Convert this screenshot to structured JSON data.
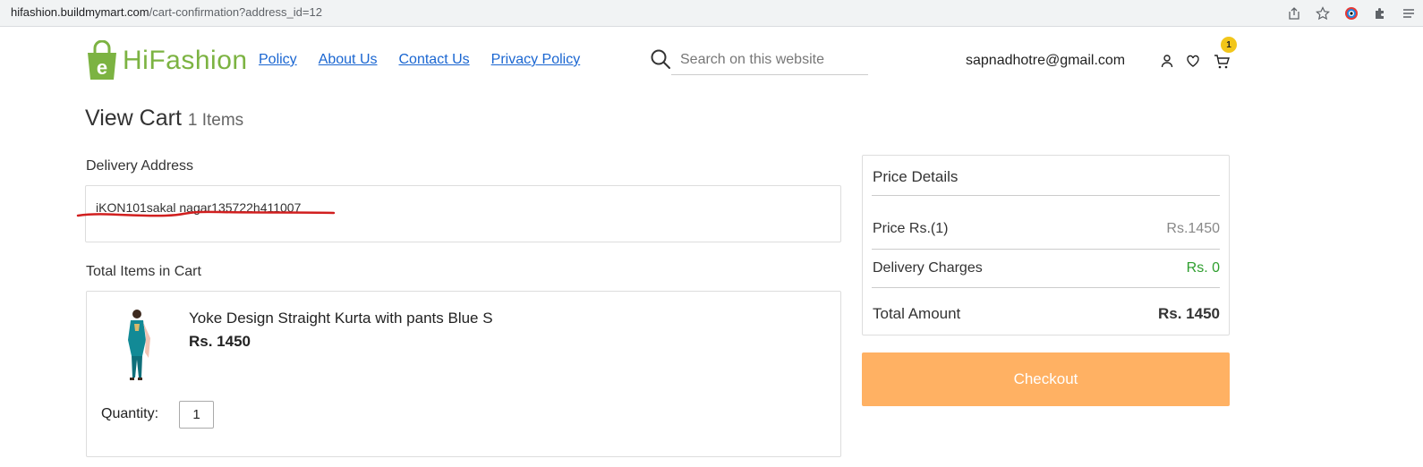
{
  "browser": {
    "url_host": "hifashion.buildmymart.com",
    "url_path": "/cart-confirmation?address_id=12",
    "icons": [
      "share-icon",
      "star-icon",
      "color-picker-icon",
      "extensions-icon",
      "menu-icon"
    ]
  },
  "header": {
    "brand": "HiFashion",
    "logo_letter": "e",
    "nav": [
      "Policy",
      "About Us",
      "Contact Us",
      "Privacy Policy"
    ],
    "search_placeholder": "Search on this website",
    "user_email": "sapnadhotre@gmail.com",
    "cart_count": "1"
  },
  "page": {
    "title": "View Cart",
    "item_count": "1 Items"
  },
  "delivery": {
    "label": "Delivery Address",
    "address": "iKON101sakal nagar135722h411007"
  },
  "cart": {
    "label": "Total Items in Cart",
    "items": [
      {
        "name": "Yoke Design Straight Kurta with pants Blue S",
        "price": "Rs. 1450",
        "quantity_label": "Quantity:",
        "quantity": "1"
      }
    ]
  },
  "price_details": {
    "title": "Price Details",
    "rows": [
      {
        "label": "Price Rs.(1)",
        "value": "Rs.1450"
      },
      {
        "label": "Delivery Charges",
        "value": "Rs. 0"
      },
      {
        "label": "Total Amount",
        "value": "Rs. 1450"
      }
    ],
    "checkout_label": "Checkout"
  },
  "colors": {
    "brand_green": "#7cb342",
    "link_blue": "#1a66d1",
    "checkout_orange": "#ffb163",
    "badge_yellow": "#f2c61a",
    "free_green": "#2e9e2e",
    "annotation_red": "#d11f1f"
  }
}
